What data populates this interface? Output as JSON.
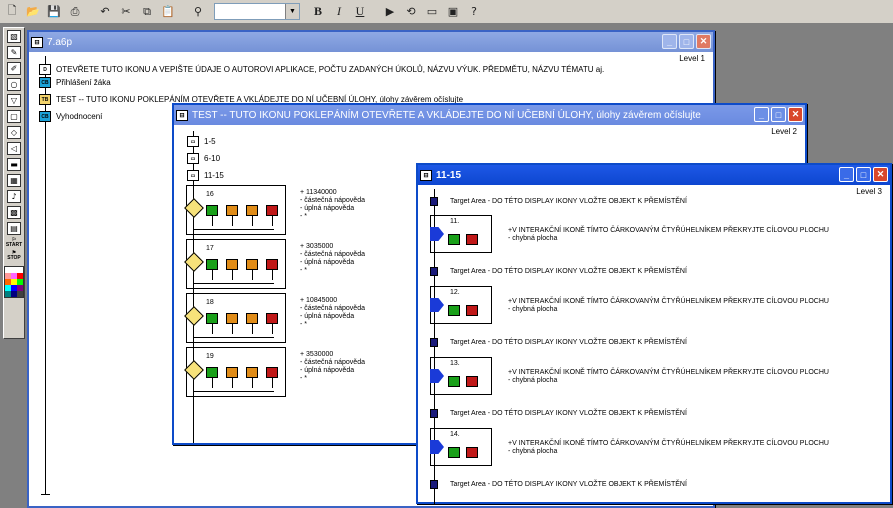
{
  "toolbar": {
    "icons": [
      "new-icon",
      "open-icon",
      "save-icon",
      "print-icon",
      "undo-icon",
      "cut-icon",
      "copy-icon",
      "paste-icon",
      "find-icon"
    ],
    "font_value": "",
    "format": [
      "B",
      "I",
      "U"
    ],
    "tools": [
      "run-icon",
      "restart-icon",
      "control-panel-icon",
      "icon-panel-icon",
      "help-icon"
    ]
  },
  "palette": {
    "icons": [
      "interaction-icon",
      "display-icon",
      "erase-icon",
      "wait-icon",
      "navigate-icon",
      "framework-icon",
      "decision-icon",
      "calc-icon",
      "map-icon",
      "digital-movie-icon",
      "sound-icon",
      "video-icon",
      "knowledge-icon"
    ],
    "start_label": "START",
    "stop_label": "STOP",
    "colors": [
      "#ffffff",
      "#ffffff",
      "#ffffff",
      "#ff9999",
      "#ff66ff",
      "#ff0000",
      "#ff6600",
      "#ffff00",
      "#00ff00",
      "#00ffff",
      "#0000ff",
      "#800080",
      "#008080",
      "#000080",
      "#404040"
    ]
  },
  "w1": {
    "title": "7.a6p",
    "level": "Level 1",
    "items": [
      {
        "icon": "D",
        "text": "OTEVŘETE TUTO IKONU A  VEPIŠTE ÚDAJE O AUTOROVI APLIKACE, POČTU ZADANÝCH  ÚKOLŮ,  NÁZVU VÝUK. PŘEDMĚTU, NÁZVU TÉMATU aj."
      },
      {
        "icon": "CB",
        "text": "Přihlášení žáka"
      },
      {
        "icon": "TB",
        "text": "TEST -- TUTO IKONU POKLEPÁNÍM OTEVŘETE A VKLÁDEJTE DO NÍ UČEBNÍ ÚLOHY, úlohy závěrem očíslujte"
      },
      {
        "icon": "CB",
        "text": "Vyhodnocení"
      }
    ]
  },
  "w2": {
    "title": "TEST -- TUTO IKONU POKLEPÁNÍM OTEVŘETE A VKLÁDEJTE DO NÍ UČEBNÍ ÚLOHY, úlohy závěrem očíslujte",
    "level": "Level 2",
    "maps": [
      "1-5",
      "6-10",
      "11-15"
    ],
    "tasks": [
      {
        "num": "16",
        "score": "+ 11340000",
        "a": "- částečná nápověda",
        "b": "- úplná nápověda",
        "c": "- *"
      },
      {
        "num": "17",
        "score": "+ 3035000",
        "a": "- částečná nápověda",
        "b": "- úplná nápověda",
        "c": "- *"
      },
      {
        "num": "18",
        "score": "+ 10845000",
        "a": "- částečná nápověda",
        "b": "- úplná nápověda",
        "c": "- *"
      },
      {
        "num": "19",
        "score": "+ 3530000",
        "a": "- částečná nápověda",
        "b": "- úplná nápověda",
        "c": "- *"
      }
    ]
  },
  "w3": {
    "title": "11-15",
    "level": "Level 3",
    "target": "Target Area - DO  TÉTO DISPLAY IKONY VLOŽTE OBJEKT K PŘEMÍSTĚNÍ",
    "tasks": [
      {
        "num": "11.",
        "text": "+V INTERAKČNÍ IKONĚ TÍMTO ČÁRKOVANÝM ČTYŘÚHELNÍKEM PŘEKRYJTE CÍLOVOU PLOCHU",
        "sub": "- chybná plocha"
      },
      {
        "num": "12.",
        "text": "+V INTERAKČNÍ IKONĚ TÍMTO ČÁRKOVANÝM ČTYŘÚHELNÍKEM PŘEKRYJTE CÍLOVOU PLOCHU",
        "sub": "- chybná plocha"
      },
      {
        "num": "13.",
        "text": "+V INTERAKČNÍ IKONĚ TÍMTO ČÁRKOVANÝM ČTYŘÚHELNÍKEM PŘEKRYJTE CÍLOVOU PLOCHU",
        "sub": "- chybná plocha"
      },
      {
        "num": "14.",
        "text": "+V INTERAKČNÍ IKONĚ TÍMTO ČÁRKOVANÝM ČTYŘÚHELNÍKEM PŘEKRYJTE CÍLOVOU PLOCHU",
        "sub": "- chybná plocha"
      }
    ]
  }
}
